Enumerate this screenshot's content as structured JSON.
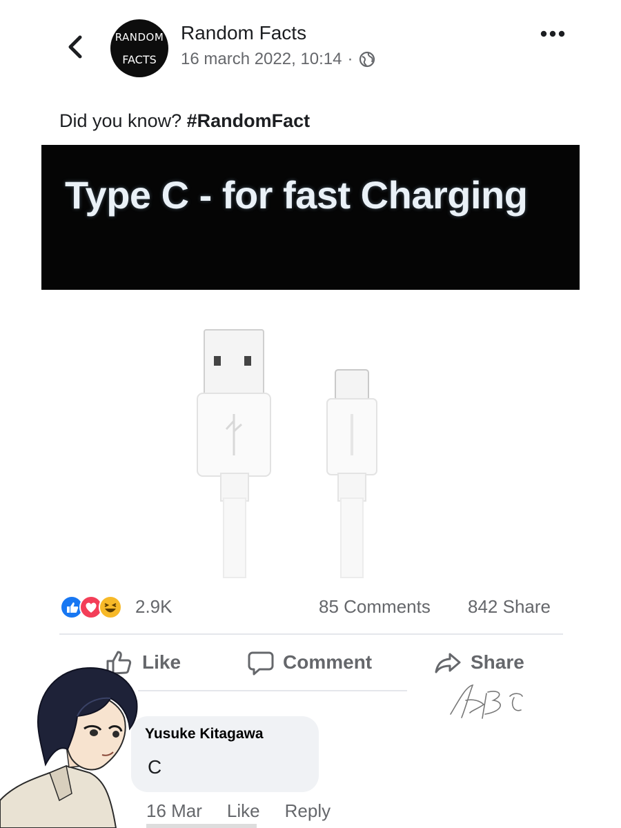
{
  "post": {
    "page_name": "Random Facts",
    "avatar_line1": "RANDOM",
    "avatar_line2": "FACTS",
    "date": "16 march 2022, 10:14",
    "separator": "·",
    "caption_plain": "Did you know? ",
    "caption_hashtag": "#RandomFact",
    "banner_text": "Type C - for fast Charging"
  },
  "stats": {
    "reactions_count": "2.9K",
    "comments": "85 Comments",
    "shares": "842 Share"
  },
  "actions": {
    "like": "Like",
    "comment": "Comment",
    "share": "Share"
  },
  "comment": {
    "author": "Yusuke Kitagawa",
    "text": "C",
    "date": "16 Mar",
    "like": "Like",
    "reply": "Reply"
  },
  "icons": {
    "back": "chevron-left-icon",
    "more": "more-dots-icon",
    "privacy": "globe-icon",
    "like": "thumbs-up-icon",
    "comment": "speech-bubble-icon",
    "share": "share-arrow-icon"
  },
  "colors": {
    "like_blue": "#1877f2",
    "love_red": "#f33e58",
    "haha_yellow": "#f7b928",
    "secondary_text": "#65676b",
    "banner_bg": "#050505"
  }
}
